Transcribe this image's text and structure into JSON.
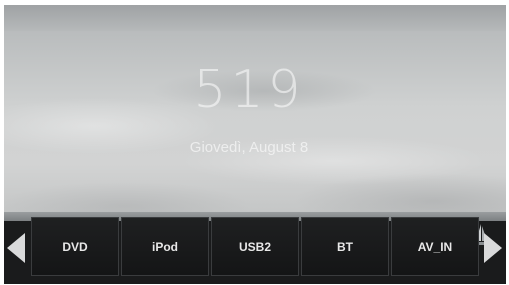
{
  "clock": {
    "time": "519",
    "date": "Giovedì, August 8"
  },
  "source_menu": {
    "items": [
      {
        "label": "DVD"
      },
      {
        "label": "iPod"
      },
      {
        "label": "USB2"
      },
      {
        "label": "BT"
      },
      {
        "label": "AV_IN"
      }
    ]
  },
  "navigation": {
    "prev_icon": "triangle-left-icon",
    "next_icon": "triangle-right-icon"
  },
  "colors": {
    "tile_background": "#1a1b1c",
    "tile_text": "#e8e8e8",
    "arrow": "#d9dadb"
  }
}
